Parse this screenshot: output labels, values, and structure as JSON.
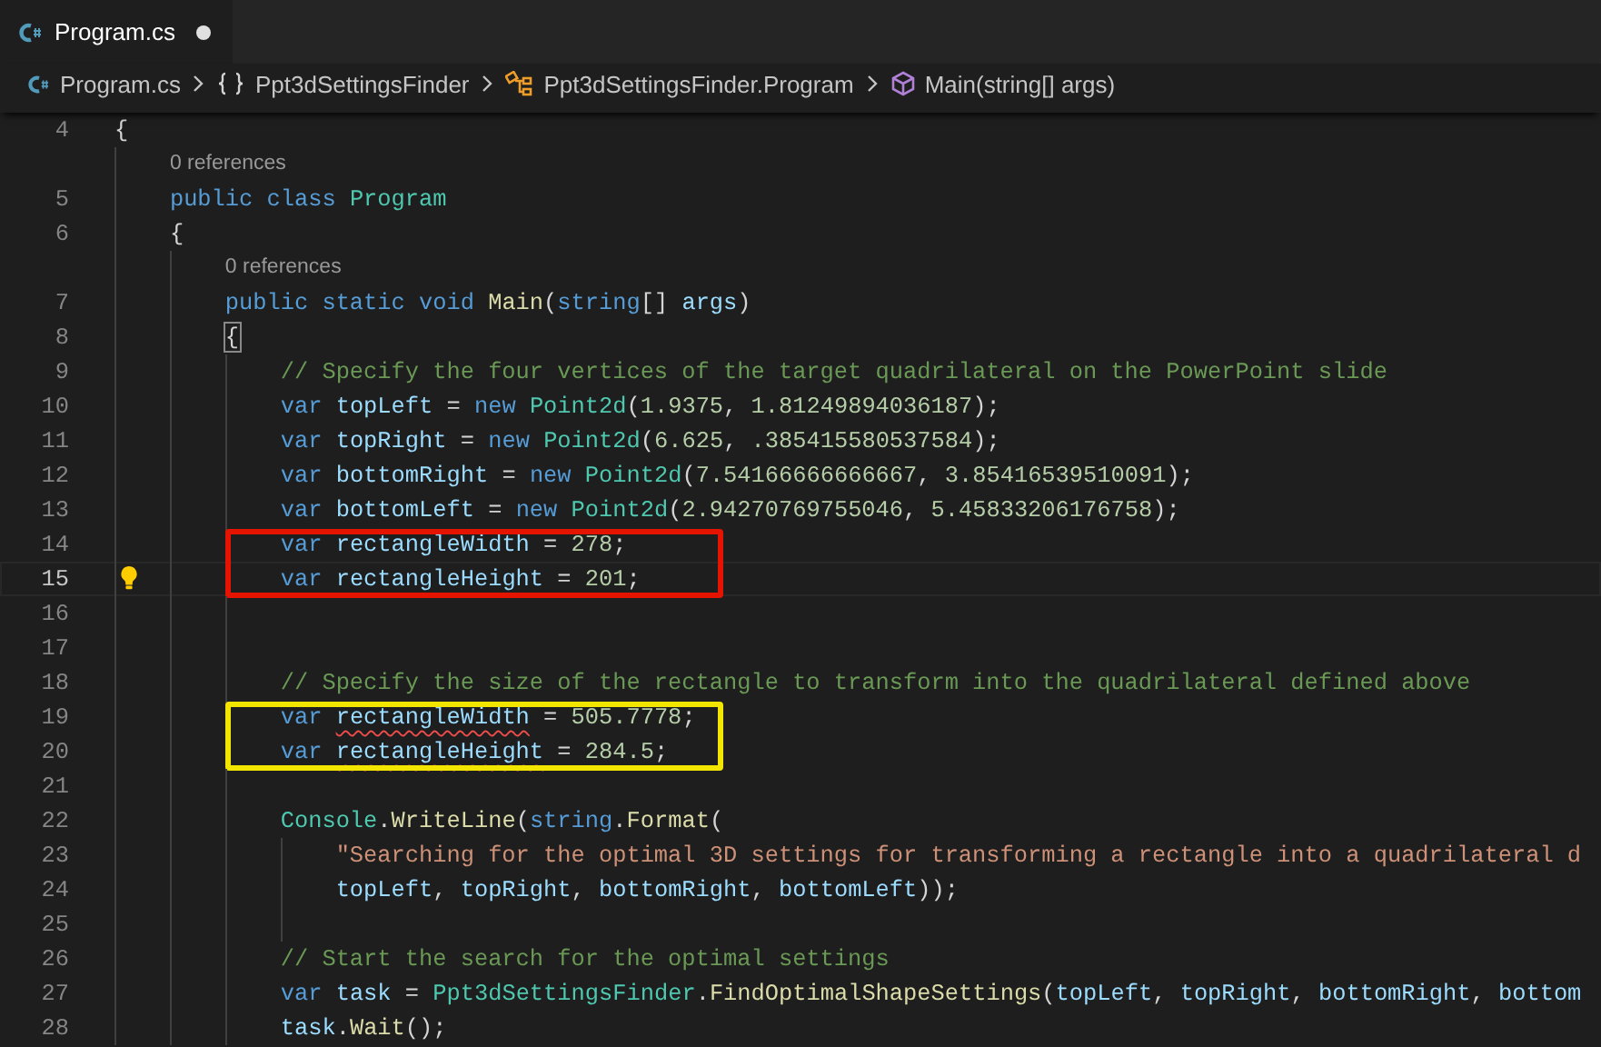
{
  "tab": {
    "label": "Program.cs",
    "modified": true
  },
  "breadcrumbs": [
    {
      "kind": "file",
      "label": "Program.cs"
    },
    {
      "kind": "namespace",
      "label": "Ppt3dSettingsFinder"
    },
    {
      "kind": "class",
      "label": "Ppt3dSettingsFinder.Program"
    },
    {
      "kind": "method",
      "label": "Main(string[] args)"
    }
  ],
  "code": [
    {
      "kind": "line",
      "number": "4",
      "current": false,
      "tokens": [
        {
          "text": "{",
          "kind": "punctuation"
        }
      ]
    },
    {
      "kind": "lens",
      "text": "    0 references"
    },
    {
      "kind": "line",
      "number": "5",
      "current": false,
      "tokens": [
        {
          "text": "    public class ",
          "kind": "keyword"
        },
        {
          "text": "Program",
          "kind": "type"
        }
      ]
    },
    {
      "kind": "line",
      "number": "6",
      "current": false,
      "tokens": [
        {
          "text": "    {",
          "kind": "punctuation"
        }
      ]
    },
    {
      "kind": "lens",
      "text": "        0 references"
    },
    {
      "kind": "line",
      "number": "7",
      "current": false,
      "tokens": [
        {
          "text": "        public static void ",
          "kind": "keyword"
        },
        {
          "text": "Main",
          "kind": "method"
        },
        {
          "text": "(",
          "kind": "punctuation"
        },
        {
          "text": "string",
          "kind": "keyword"
        },
        {
          "text": "[] ",
          "kind": "punctuation"
        },
        {
          "text": "args",
          "kind": "variable"
        },
        {
          "text": ")",
          "kind": "punctuation"
        }
      ]
    },
    {
      "kind": "line",
      "number": "8",
      "current": false,
      "tokens": [
        {
          "text": "        {",
          "kind": "bracket-match"
        }
      ]
    },
    {
      "kind": "line",
      "number": "9",
      "current": false,
      "tokens": [
        {
          "text": "            // Specify the four vertices of the target quadrilateral on the PowerPoint slide",
          "kind": "comment"
        }
      ]
    },
    {
      "kind": "line",
      "number": "10",
      "current": false,
      "tokens": [
        {
          "text": "            var ",
          "kind": "keyword"
        },
        {
          "text": "topLeft",
          "kind": "variable"
        },
        {
          "text": " = ",
          "kind": "punctuation"
        },
        {
          "text": "new ",
          "kind": "keyword"
        },
        {
          "text": "Point2d",
          "kind": "type"
        },
        {
          "text": "(",
          "kind": "punctuation"
        },
        {
          "text": "1.9375",
          "kind": "number"
        },
        {
          "text": ", ",
          "kind": "punctuation"
        },
        {
          "text": "1.81249894036187",
          "kind": "number"
        },
        {
          "text": ");",
          "kind": "punctuation"
        }
      ]
    },
    {
      "kind": "line",
      "number": "11",
      "current": false,
      "tokens": [
        {
          "text": "            var ",
          "kind": "keyword"
        },
        {
          "text": "topRight",
          "kind": "variable"
        },
        {
          "text": " = ",
          "kind": "punctuation"
        },
        {
          "text": "new ",
          "kind": "keyword"
        },
        {
          "text": "Point2d",
          "kind": "type"
        },
        {
          "text": "(",
          "kind": "punctuation"
        },
        {
          "text": "6.625",
          "kind": "number"
        },
        {
          "text": ", ",
          "kind": "punctuation"
        },
        {
          "text": ".385415580537584",
          "kind": "number"
        },
        {
          "text": ");",
          "kind": "punctuation"
        }
      ]
    },
    {
      "kind": "line",
      "number": "12",
      "current": false,
      "tokens": [
        {
          "text": "            var ",
          "kind": "keyword"
        },
        {
          "text": "bottomRight",
          "kind": "variable"
        },
        {
          "text": " = ",
          "kind": "punctuation"
        },
        {
          "text": "new ",
          "kind": "keyword"
        },
        {
          "text": "Point2d",
          "kind": "type"
        },
        {
          "text": "(",
          "kind": "punctuation"
        },
        {
          "text": "7.54166666666667",
          "kind": "number"
        },
        {
          "text": ", ",
          "kind": "punctuation"
        },
        {
          "text": "3.85416539510091",
          "kind": "number"
        },
        {
          "text": ");",
          "kind": "punctuation"
        }
      ]
    },
    {
      "kind": "line",
      "number": "13",
      "current": false,
      "tokens": [
        {
          "text": "            var ",
          "kind": "keyword"
        },
        {
          "text": "bottomLeft",
          "kind": "variable"
        },
        {
          "text": " = ",
          "kind": "punctuation"
        },
        {
          "text": "new ",
          "kind": "keyword"
        },
        {
          "text": "Point2d",
          "kind": "type"
        },
        {
          "text": "(",
          "kind": "punctuation"
        },
        {
          "text": "2.94270769755046",
          "kind": "number"
        },
        {
          "text": ", ",
          "kind": "punctuation"
        },
        {
          "text": "5.45833206176758",
          "kind": "number"
        },
        {
          "text": ");",
          "kind": "punctuation"
        }
      ]
    },
    {
      "kind": "box",
      "color": "#e51400",
      "lines": [
        {
          "kind": "line",
          "number": "14",
          "current": false,
          "tokens": [
            {
              "text": "            var ",
              "kind": "keyword"
            },
            {
              "text": "rectangleWidth",
              "kind": "variable"
            },
            {
              "text": " = ",
              "kind": "punctuation"
            },
            {
              "text": "278",
              "kind": "number"
            },
            {
              "text": ";",
              "kind": "punctuation"
            }
          ]
        },
        {
          "kind": "line",
          "number": "15",
          "current": true,
          "tokens": [
            {
              "text": "            var ",
              "kind": "keyword"
            },
            {
              "text": "rectangleHeight",
              "kind": "variable"
            },
            {
              "text": " = ",
              "kind": "punctuation"
            },
            {
              "text": "201",
              "kind": "number"
            },
            {
              "text": ";",
              "kind": "punctuation"
            }
          ]
        }
      ]
    },
    {
      "kind": "line",
      "number": "16",
      "current": false
    },
    {
      "kind": "line",
      "number": "17",
      "current": false
    },
    {
      "kind": "line",
      "number": "18",
      "current": false,
      "tokens": [
        {
          "text": "            // Specify the size of the rectangle to transform into the quadrilateral defined above",
          "kind": "comment"
        }
      ]
    },
    {
      "kind": "box",
      "color": "#f2e600",
      "lines": [
        {
          "kind": "line",
          "number": "19",
          "current": false,
          "tokens": [
            {
              "text": "            var ",
              "kind": "keyword"
            },
            {
              "text": "rectangleWidth",
              "kind": "variable-warning"
            },
            {
              "text": " = ",
              "kind": "punctuation"
            },
            {
              "text": "505.7778",
              "kind": "number"
            },
            {
              "text": ";",
              "kind": "punctuation"
            }
          ]
        },
        {
          "kind": "line",
          "number": "20",
          "current": false,
          "tokens": [
            {
              "text": "            var ",
              "kind": "keyword"
            },
            {
              "text": "rectangleHeight",
              "kind": "variable-warning"
            },
            {
              "text": " = ",
              "kind": "punctuation"
            },
            {
              "text": "284.5",
              "kind": "number"
            },
            {
              "text": ";",
              "kind": "punctuation"
            }
          ]
        }
      ]
    },
    {
      "kind": "line",
      "number": "21",
      "current": false
    },
    {
      "kind": "line",
      "number": "22",
      "current": false,
      "tokens": [
        {
          "text": "            Console",
          "kind": "type"
        },
        {
          "text": ".",
          "kind": "punctuation"
        },
        {
          "text": "WriteLine",
          "kind": "method"
        },
        {
          "text": "(",
          "kind": "punctuation"
        },
        {
          "text": "string",
          "kind": "keyword"
        },
        {
          "text": ".",
          "kind": "punctuation"
        },
        {
          "text": "Format",
          "kind": "method"
        },
        {
          "text": "(",
          "kind": "punctuation"
        }
      ]
    },
    {
      "kind": "line",
      "number": "23",
      "current": false,
      "tokens": [
        {
          "text": "                \"Searching for the optimal 3D settings for transforming a rectangle into a quadrilateral d",
          "kind": "string"
        }
      ]
    },
    {
      "kind": "line",
      "number": "24",
      "current": false,
      "tokens": [
        {
          "text": "                topLeft",
          "kind": "variable"
        },
        {
          "text": ", ",
          "kind": "punctuation"
        },
        {
          "text": "topRight",
          "kind": "variable"
        },
        {
          "text": ", ",
          "kind": "punctuation"
        },
        {
          "text": "bottomRight",
          "kind": "variable"
        },
        {
          "text": ", ",
          "kind": "punctuation"
        },
        {
          "text": "bottomLeft",
          "kind": "variable"
        },
        {
          "text": "));",
          "kind": "punctuation"
        }
      ]
    },
    {
      "kind": "line",
      "number": "25",
      "current": false
    },
    {
      "kind": "line",
      "number": "26",
      "current": false,
      "tokens": [
        {
          "text": "            // Start the search for the optimal settings",
          "kind": "comment"
        }
      ]
    },
    {
      "kind": "line",
      "number": "27",
      "current": false,
      "tokens": [
        {
          "text": "            var ",
          "kind": "keyword"
        },
        {
          "text": "task",
          "kind": "variable"
        },
        {
          "text": " = ",
          "kind": "punctuation"
        },
        {
          "text": "Ppt3dSettingsFinder",
          "kind": "type"
        },
        {
          "text": ".",
          "kind": "punctuation"
        },
        {
          "text": "FindOptimalShapeSettings",
          "kind": "method"
        },
        {
          "text": "(",
          "kind": "punctuation"
        },
        {
          "text": "topLeft",
          "kind": "variable"
        },
        {
          "text": ", ",
          "kind": "punctuation"
        },
        {
          "text": "topRight",
          "kind": "variable"
        },
        {
          "text": ", ",
          "kind": "punctuation"
        },
        {
          "text": "bottomRight",
          "kind": "variable"
        },
        {
          "text": ", ",
          "kind": "punctuation"
        },
        {
          "text": "bottom",
          "kind": "variable"
        }
      ]
    },
    {
      "kind": "line",
      "number": "28",
      "current": false,
      "tokens": [
        {
          "text": "            task",
          "kind": "variable"
        },
        {
          "text": ".",
          "kind": "punctuation"
        },
        {
          "text": "Wait",
          "kind": "method"
        },
        {
          "text": "();",
          "kind": "punctuation"
        }
      ]
    }
  ]
}
